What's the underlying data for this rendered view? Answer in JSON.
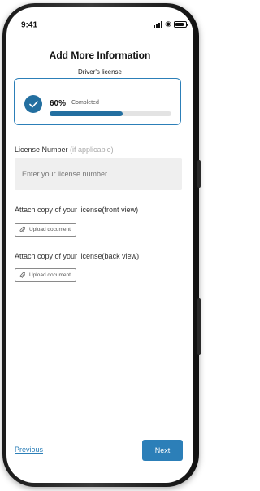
{
  "status_bar": {
    "time": "9:41"
  },
  "header": {
    "title": "Add More Information",
    "subtitle": "Driver's license"
  },
  "progress": {
    "percent_text": "60%",
    "status_text": "Completed",
    "value": 0.6
  },
  "license": {
    "label": "License Number",
    "optional_hint": "(if applicable)",
    "placeholder": "Enter your license number",
    "value": ""
  },
  "attachments": [
    {
      "label": "Attach copy of your license(front view)",
      "button_label": "Upload document"
    },
    {
      "label": "Attach copy of your license(back view)",
      "button_label": "Upload document"
    }
  ],
  "footer": {
    "previous_label": "Previous",
    "next_label": "Next"
  },
  "colors": {
    "accent": "#2c7fb8",
    "progress_fill": "#236fa0",
    "input_bg": "#efefef"
  }
}
